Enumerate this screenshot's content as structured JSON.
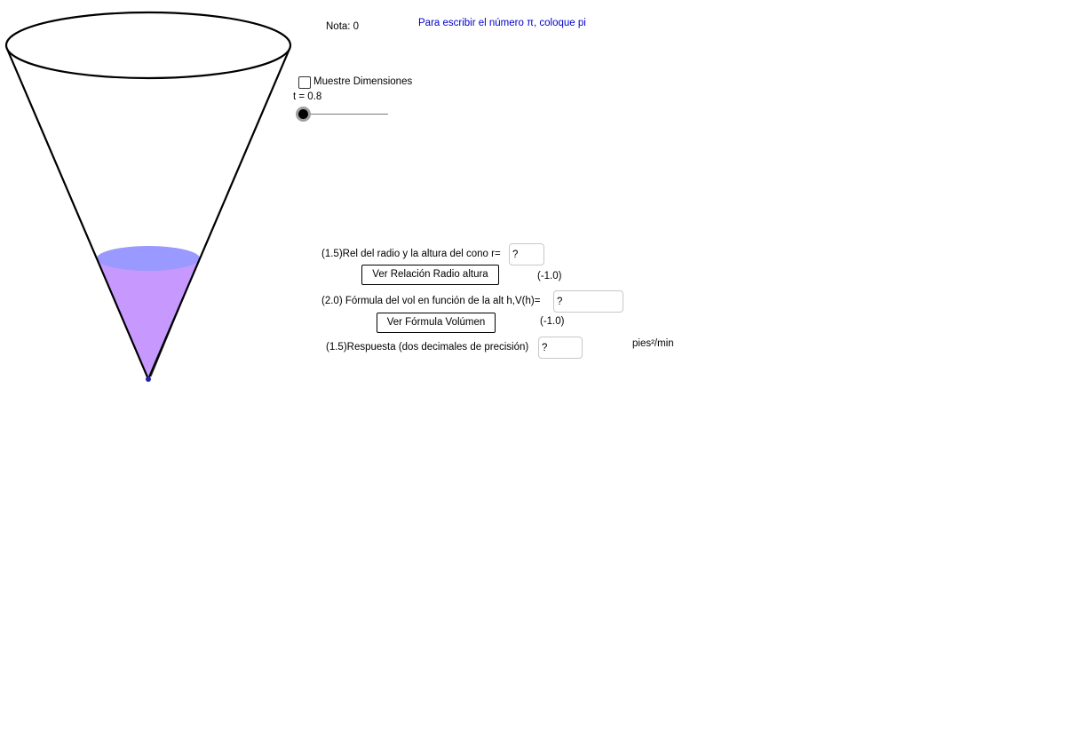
{
  "header": {
    "score_label": "Nota: 0",
    "pi_hint": "Para escribir el número π,  coloque pi",
    "pi_hint_color": "#0000cc"
  },
  "controls": {
    "show_dimensions_label": "Muestre Dimensiones",
    "show_dimensions_checked": false,
    "slider_label": "t = 0.8",
    "slider_value": 0.8
  },
  "questions": [
    {
      "prompt": "(1.5)Rel del radio y la altura del cono r=",
      "answer": "?",
      "hint_button": "Ver Relación Radio altura",
      "penalty": "(-1.0)"
    },
    {
      "prompt": "(2.0) Fórmula  del vol en función de la alt h,V(h)=",
      "answer": "?",
      "hint_button": "Ver Fórmula Volúmen",
      "penalty": "(-1.0)"
    },
    {
      "prompt": "(1.5)Respuesta (dos decimales de precisión)",
      "answer": "?",
      "unit": "pies²/min"
    }
  ],
  "figure": {
    "water_fill_color": "#c799ff",
    "water_surface_color": "#9999ff",
    "vertex_color": "#2222aa"
  }
}
